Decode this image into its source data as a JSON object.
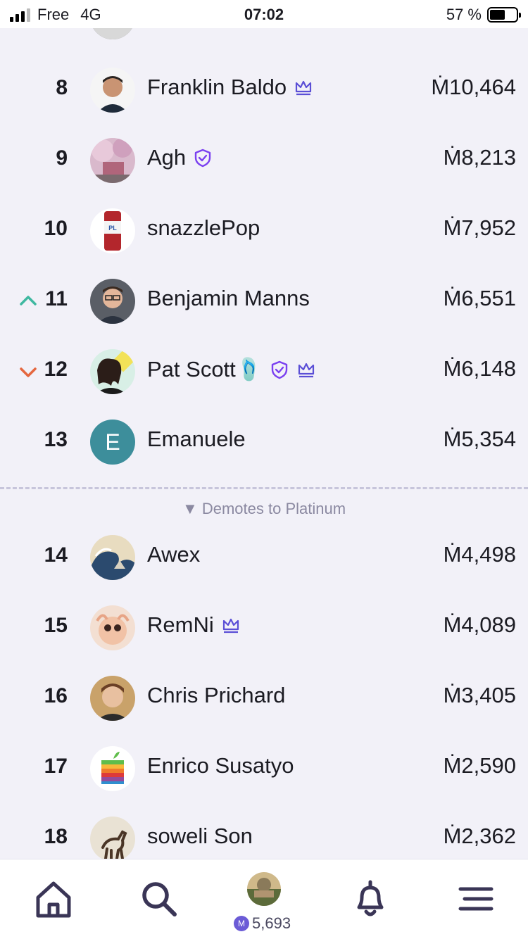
{
  "status_bar": {
    "carrier": "Free",
    "network": "4G",
    "time": "07:02",
    "battery_percent": "57 %"
  },
  "rows": [
    {
      "rank": "8",
      "name": "Franklin Baldo",
      "amount": "Ṁ10,464",
      "badges": [
        "crown-icon"
      ]
    },
    {
      "rank": "9",
      "name": "Agh",
      "amount": "Ṁ8,213",
      "badges": [
        "shield-check-icon"
      ]
    },
    {
      "rank": "10",
      "name": "snazzlePop",
      "amount": "Ṁ7,952",
      "badges": []
    },
    {
      "rank": "11",
      "name": "Benjamin Manns",
      "amount": "Ṁ6,551",
      "trend": "up",
      "badges": []
    },
    {
      "rank": "12",
      "name": "Pat Scott🩴",
      "amount": "Ṁ6,148",
      "trend": "down",
      "badges": [
        "shield-check-icon",
        "crown-icon"
      ]
    },
    {
      "rank": "13",
      "name": "Emanuele",
      "amount": "Ṁ5,354",
      "avatar_letter": "E",
      "badges": []
    },
    {
      "rank": "14",
      "name": "Awex",
      "amount": "Ṁ4,498",
      "badges": []
    },
    {
      "rank": "15",
      "name": "RemNi",
      "amount": "Ṁ4,089",
      "badges": [
        "crown-icon"
      ]
    },
    {
      "rank": "16",
      "name": "Chris Prichard",
      "amount": "Ṁ3,405",
      "badges": []
    },
    {
      "rank": "17",
      "name": "Enrico Susatyo",
      "amount": "Ṁ2,590",
      "badges": []
    },
    {
      "rank": "18",
      "name": "soweli Son",
      "amount": "Ṁ2,362",
      "badges": []
    }
  ],
  "demote_label": "▼ Demotes to Platinum",
  "bottom_nav": {
    "items": [
      "home-icon",
      "search-icon",
      "profile-avatar",
      "bell-icon",
      "menu-icon"
    ],
    "balance": "5,693",
    "coin_symbol": "M"
  },
  "colors": {
    "background": "#f2f1f8",
    "accent": "#5b4fd6",
    "shield": "#7a3ff0",
    "trend_up": "#3fb8a0",
    "trend_down": "#e5673f",
    "divider": "#c7c5db"
  }
}
